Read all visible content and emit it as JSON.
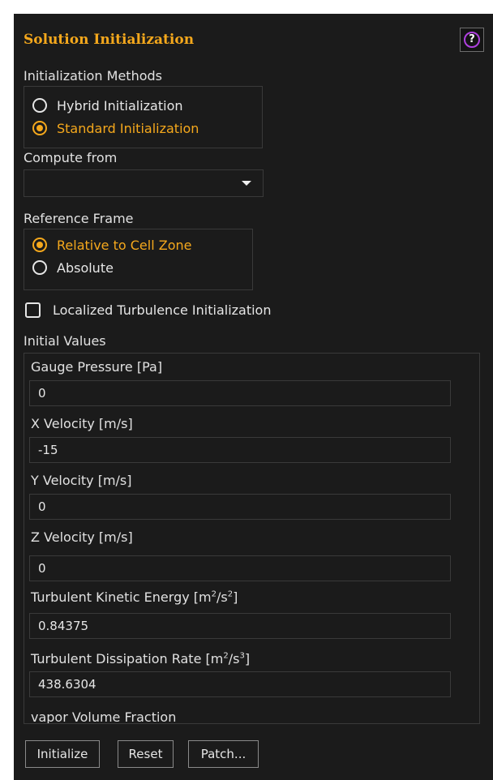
{
  "panel": {
    "title": "Solution Initialization",
    "help_glyph": "?"
  },
  "initialization_methods": {
    "label": "Initialization Methods",
    "options": [
      {
        "label": "Hybrid  Initialization",
        "selected": false
      },
      {
        "label": "Standard Initialization",
        "selected": true
      }
    ]
  },
  "compute_from": {
    "label": "Compute from",
    "value": ""
  },
  "reference_frame": {
    "label": "Reference Frame",
    "options": [
      {
        "label": "Relative to Cell Zone",
        "selected": true
      },
      {
        "label": "Absolute",
        "selected": false
      }
    ]
  },
  "localized_turbulence": {
    "label": "Localized Turbulence Initialization",
    "checked": false
  },
  "initial_values": {
    "label": "Initial Values",
    "fields": [
      {
        "label": "Gauge Pressure [Pa]",
        "value": "0"
      },
      {
        "label": "X Velocity [m/s]",
        "value": "-15"
      },
      {
        "label": "Y Velocity [m/s]",
        "value": "0"
      },
      {
        "label": "Z Velocity [m/s]",
        "value": "0"
      },
      {
        "label_main": "Turbulent Kinetic Energy [m",
        "label_sup1": "2",
        "label_mid": "/s",
        "label_sup2": "2",
        "label_end": "]",
        "value": "0.84375"
      },
      {
        "label_main": "Turbulent Dissipation Rate [m",
        "label_sup1": "2",
        "label_mid": "/s",
        "label_sup2": "3",
        "label_end": "]",
        "value": "438.6304"
      },
      {
        "label": "vapor Volume Fraction"
      }
    ]
  },
  "buttons": {
    "initialize": "Initialize",
    "reset": "Reset",
    "patch": "Patch..."
  },
  "colors": {
    "background": "#1b1b1b",
    "accent": "#f5a81c",
    "help_ring": "#b041e0",
    "border": "#3a3a3a"
  },
  "icons": {
    "help": "help-icon",
    "dropdown": "chevron-down-icon",
    "scroll_up": "scroll-up-icon",
    "scroll_down": "scroll-down-icon"
  }
}
